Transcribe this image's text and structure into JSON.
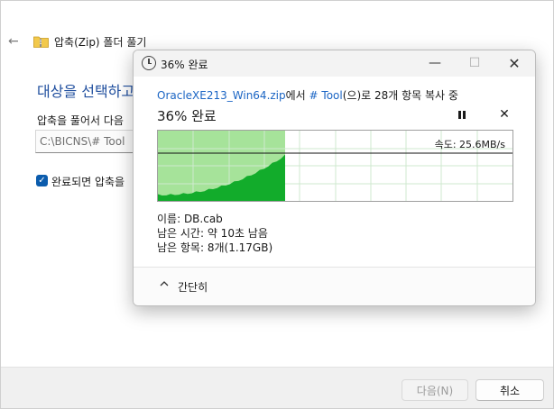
{
  "wizard": {
    "title": "압축(Zip) 폴더 풀기",
    "heading": "대상을 선택하고",
    "label": "압축을 풀어서 다음",
    "path_value": "C:\\BICNS\\# Tool",
    "checkbox_label": "완료되면 압축을",
    "checkbox_checked": true,
    "next_button": "다음(N)",
    "cancel_button": "취소"
  },
  "dialog": {
    "title": "36% 완료",
    "source_file": "OracleXE213_Win64.zip",
    "source_middle": "에서 ",
    "destination": "# Tool",
    "source_suffix": "(으)로 28개 항목 복사 중",
    "percent_text": "36% 완료",
    "progress_percent": 36,
    "speed_label": "속도: 25.6MB/s",
    "name_line": "이름: DB.cab",
    "time_line": "남은 시간: 약 10초 남음",
    "items_line": "남은 항목: 8개(1.17GB)",
    "collapse_label": "간단히"
  },
  "colors": {
    "accent": "#1b65c4",
    "progress_fill": "#a6e39a",
    "graph_fill": "#12ac2b",
    "heading": "#1f4e9e"
  },
  "icons": {
    "back": "back-arrow-icon",
    "folder": "zip-folder-icon",
    "clock": "clock-icon",
    "pause": "pause-icon",
    "stop": "stop-icon",
    "collapse": "chevron-up-icon"
  }
}
